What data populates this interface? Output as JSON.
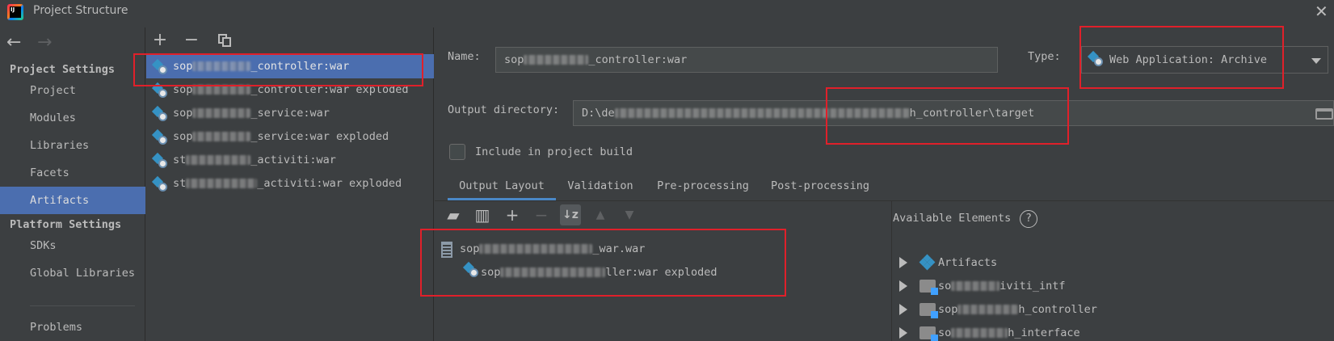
{
  "window": {
    "title": "Project Structure",
    "logo_text": "IJ"
  },
  "nav": {
    "back_glyph": "←",
    "forward_glyph": "→",
    "project_settings_header": "Project Settings",
    "project_items": [
      "Project",
      "Modules",
      "Libraries",
      "Facets",
      "Artifacts"
    ],
    "selected": "Artifacts",
    "platform_settings_header": "Platform Settings",
    "platform_items": [
      "SDKs",
      "Global Libraries"
    ],
    "problems": "Problems"
  },
  "artifacts": {
    "toolbar": {
      "add": "+",
      "remove": "−"
    },
    "items": [
      {
        "prefix": "sop",
        "suffix": "_controller:war"
      },
      {
        "prefix": "sop",
        "suffix": "_controller:war exploded"
      },
      {
        "prefix": "sop",
        "suffix": "_service:war"
      },
      {
        "prefix": "sop",
        "suffix": "_service:war exploded"
      },
      {
        "prefix": "st",
        "suffix": "_activiti:war"
      },
      {
        "prefix": "st",
        "suffix": "_activiti:war exploded"
      }
    ]
  },
  "details": {
    "name_label": "Name:",
    "name_prefix": "sop",
    "name_suffix": "_controller:war",
    "type_label": "Type:",
    "type_value": "Web Application: Archive",
    "output_label": "Output directory:",
    "output_prefix": "D:\\de",
    "output_suffix": "h_controller\\target",
    "include_label": "Include in project build",
    "include_checked": false
  },
  "tabs": [
    "Output Layout",
    "Validation",
    "Pre-processing",
    "Post-processing"
  ],
  "active_tab": "Output Layout",
  "layout_tree": {
    "root_prefix": "sop",
    "root_suffix": "_war.war",
    "child_prefix": "sop",
    "child_suffix": "ller:war exploded"
  },
  "available": {
    "header": "Available Elements",
    "help": "?",
    "items": [
      {
        "prefix": "",
        "suffix": "Artifacts"
      },
      {
        "prefix": "so",
        "suffix": "iviti_intf"
      },
      {
        "prefix": "sop",
        "suffix": "h_controller"
      },
      {
        "prefix": "so",
        "suffix": "h_interface"
      }
    ]
  },
  "colors": {
    "background": "#3c3f41",
    "selection": "#4b6eaf",
    "annotation_red": "#e0202a",
    "tab_underline": "#4a88c7"
  }
}
